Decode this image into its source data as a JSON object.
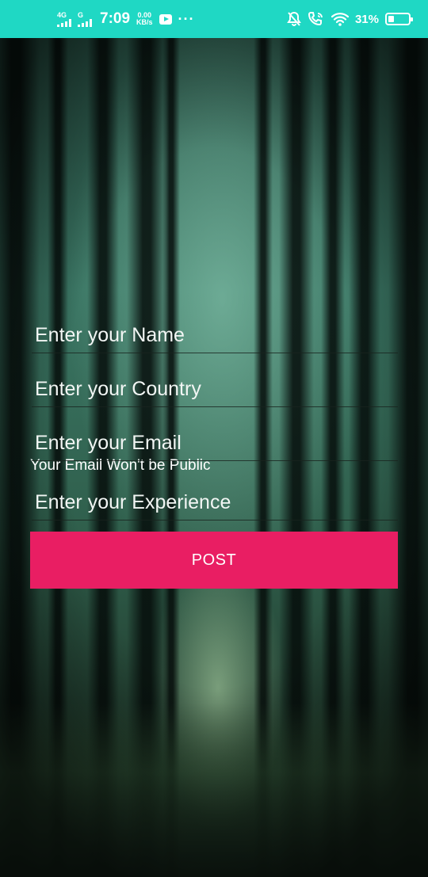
{
  "status_bar": {
    "net1": "4G",
    "net2": "G",
    "time": "7:09",
    "speed_value": "0.00",
    "speed_unit": "KB/s",
    "more": "···",
    "battery_percent": "31%",
    "battery_level": 0.31,
    "color": "#1fd8c4"
  },
  "form": {
    "name_placeholder": "Enter your Name",
    "country_placeholder": "Enter your Country",
    "email_placeholder": "Enter your Email",
    "email_hint": "Your Email Won't be Public",
    "experience_placeholder": "Enter your Experience",
    "post_label": "POST",
    "accent": "#e91e63"
  }
}
